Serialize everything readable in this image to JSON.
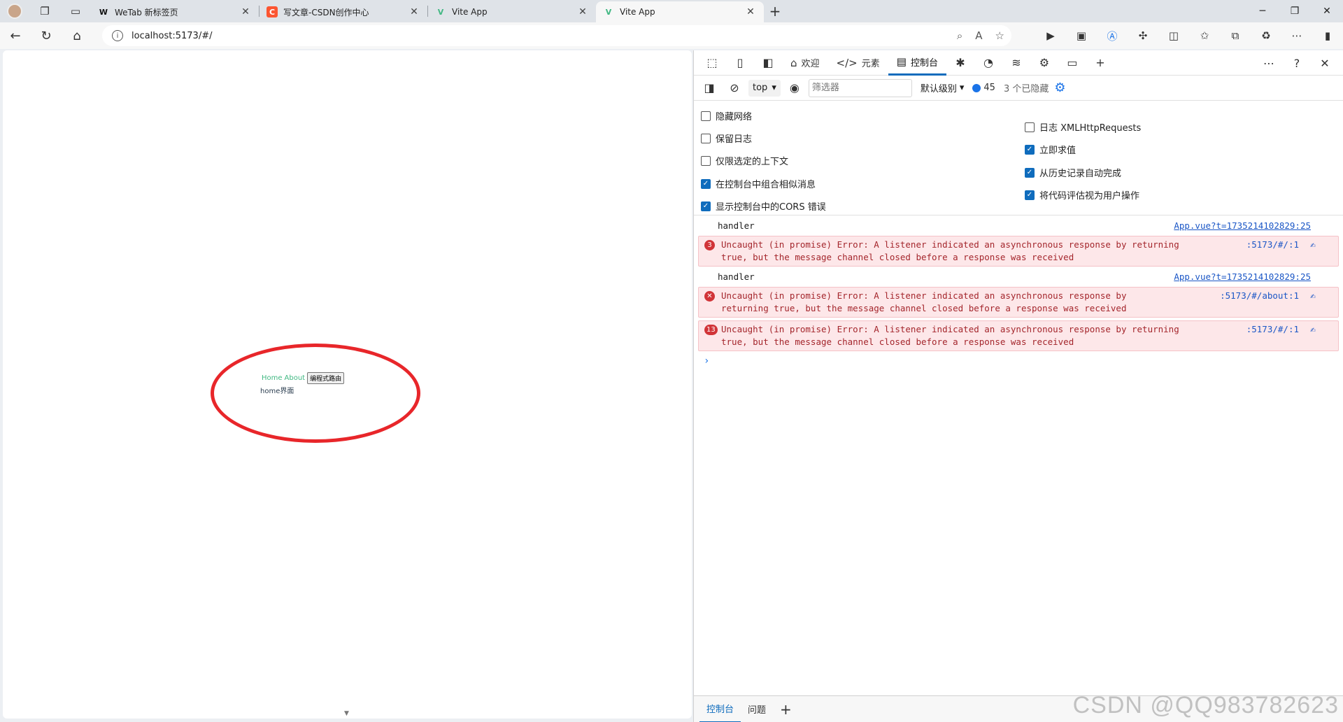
{
  "browser": {
    "tabs": [
      {
        "title": "WeTab 新标签页",
        "favicon": "W",
        "favicon_color": "#111111",
        "active": false
      },
      {
        "title": "写文章-CSDN创作中心",
        "favicon": "C",
        "favicon_color": "#fc5531",
        "active": false
      },
      {
        "title": "Vite App",
        "favicon": "V",
        "favicon_color": "#42b883",
        "active": false
      },
      {
        "title": "Vite App",
        "favicon": "V",
        "favicon_color": "#42b883",
        "active": true
      }
    ],
    "url": "localhost:5173/#/"
  },
  "page": {
    "link_home": "Home",
    "link_about": "About",
    "button_label": "编程式路由",
    "content_text": "home界面",
    "link_color": "#42b983",
    "annotation_color": "#e8262a"
  },
  "devtools": {
    "tabs": {
      "welcome": "欢迎",
      "elements": "元素",
      "console": "控制台"
    },
    "filter": {
      "context": "top",
      "placeholder": "筛选器",
      "level": "默认级别",
      "message_count": "45",
      "hidden": "3 个已隐藏"
    },
    "settings_left": [
      {
        "label": "隐藏网络",
        "checked": false
      },
      {
        "label": "保留日志",
        "checked": false
      },
      {
        "label": "仅限选定的上下文",
        "checked": false
      },
      {
        "label": "在控制台中组合相似消息",
        "checked": true
      },
      {
        "label": "显示控制台中的CORS 错误",
        "checked": true
      }
    ],
    "settings_right": [
      {
        "label": "日志 XMLHttpRequests",
        "checked": false
      },
      {
        "label": "立即求值",
        "checked": true
      },
      {
        "label": "从历史记录自动完成",
        "checked": true
      },
      {
        "label": "将代码评估视为用户操作",
        "checked": true
      }
    ],
    "logs": [
      {
        "type": "log",
        "text": "handler",
        "source": "App.vue?t=1735214102829:25"
      },
      {
        "type": "error",
        "count": "3",
        "line1": "Uncaught (in promise) Error: A listener indicated an asynchronous response by returning",
        "line2": "true, but the message channel closed before a response was received",
        "source": ":5173/#/:1"
      },
      {
        "type": "log",
        "text": "handler",
        "source": "App.vue?t=1735214102829:25"
      },
      {
        "type": "error",
        "count": "✕",
        "line1": "Uncaught (in promise) Error: A listener indicated an asynchronous response by",
        "line2": "returning true, but the message channel closed before a response was received",
        "source": ":5173/#/about:1"
      },
      {
        "type": "error",
        "count": "13",
        "line1": "Uncaught (in promise) Error: A listener indicated an asynchronous response by returning",
        "line2": "true, but the message channel closed before a response was received",
        "source": ":5173/#/:1"
      }
    ],
    "drawer": {
      "console": "控制台",
      "issues": "问题"
    }
  },
  "watermark": "CSDN @QQ983782623"
}
